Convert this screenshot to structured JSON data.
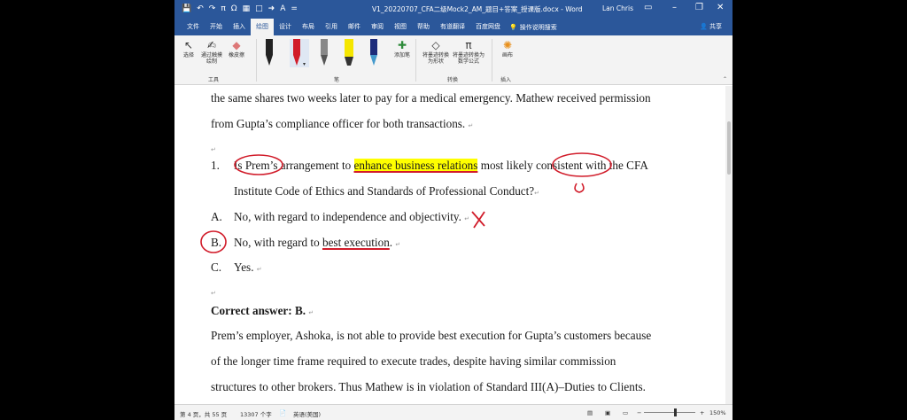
{
  "titlebar": {
    "doc_title": "V1_20220707_CFA二级Mock2_AM_题目+答案_授课版.docx - Word",
    "user_name": "Lan Chris",
    "qat_save_icon": "💾",
    "qat_undo_icon": "↶",
    "qat_redo_icon": "↷",
    "qat_pi": "π",
    "qat_omega": "Ω",
    "qat_more": "="
  },
  "tabs": {
    "items": [
      "文件",
      "开始",
      "插入",
      "绘图",
      "设计",
      "布局",
      "引用",
      "邮件",
      "审阅",
      "视图",
      "帮助",
      "有道翻译",
      "百度网盘"
    ],
    "active_index": 3,
    "search": "操作说明搜索",
    "share": "共享"
  },
  "ribbon": {
    "tools_buttons": [
      "选择",
      "通过触摸绘制",
      "橡皮擦"
    ],
    "group_tools": "工具",
    "group_pens": "笔",
    "add_pen": "添加笔",
    "convert_buttons": [
      "将墨迹转换为形状",
      "将墨迹转换为数学公式"
    ],
    "group_convert": "转换",
    "canvas": "画布",
    "group_insert": "插入",
    "pens": [
      {
        "color": "#222222",
        "type": "pen"
      },
      {
        "color": "#d11c2a",
        "type": "pen"
      },
      {
        "color": "#555555",
        "type": "pen"
      },
      {
        "color": "#f5e600",
        "type": "highlighter"
      },
      {
        "color": "#1d2c7a",
        "type": "pen"
      }
    ]
  },
  "document": {
    "line1": "the same shares two weeks later to pay for a medical emergency. Mathew received permission",
    "line2": "from Gupta’s compliance officer for both transactions.",
    "q_number": "1.",
    "q_part1": "Is Prem’s arrangement to ",
    "q_highlight": "enhance business relations",
    "q_part2": " most likely consistent with the CFA",
    "q_line2": "Institute Code of Ethics and Standards of Professional Conduct?",
    "optA_label": "A.",
    "optA_text": "No, with regard to independence and objectivity.",
    "optB_label": "B.",
    "optB_prefix": "No, with regard to ",
    "optB_underlined": "best execution",
    "optB_suffix": ".",
    "optC_label": "C.",
    "optC_text": "Yes.",
    "answer_label": "Correct answer: B.",
    "exp1": "Prem’s employer, Ashoka, is not able to provide best execution for Gupta’s customers because",
    "exp2": "of the longer time frame required to execute trades, despite having similar commission",
    "exp3": "structures to other brokers. Thus Mathew is in violation of Standard III(A)–Duties to Clients.",
    "para_mark": "↵",
    "accent_ink": "#d11c2a",
    "highlight_color": "#ffff00"
  },
  "statusbar": {
    "page": "第 4 页，共 55 页",
    "words": "13307 个字",
    "lang": "英语(美国)",
    "zoom": "150%",
    "zoom_minus": "−",
    "zoom_plus": "+"
  }
}
